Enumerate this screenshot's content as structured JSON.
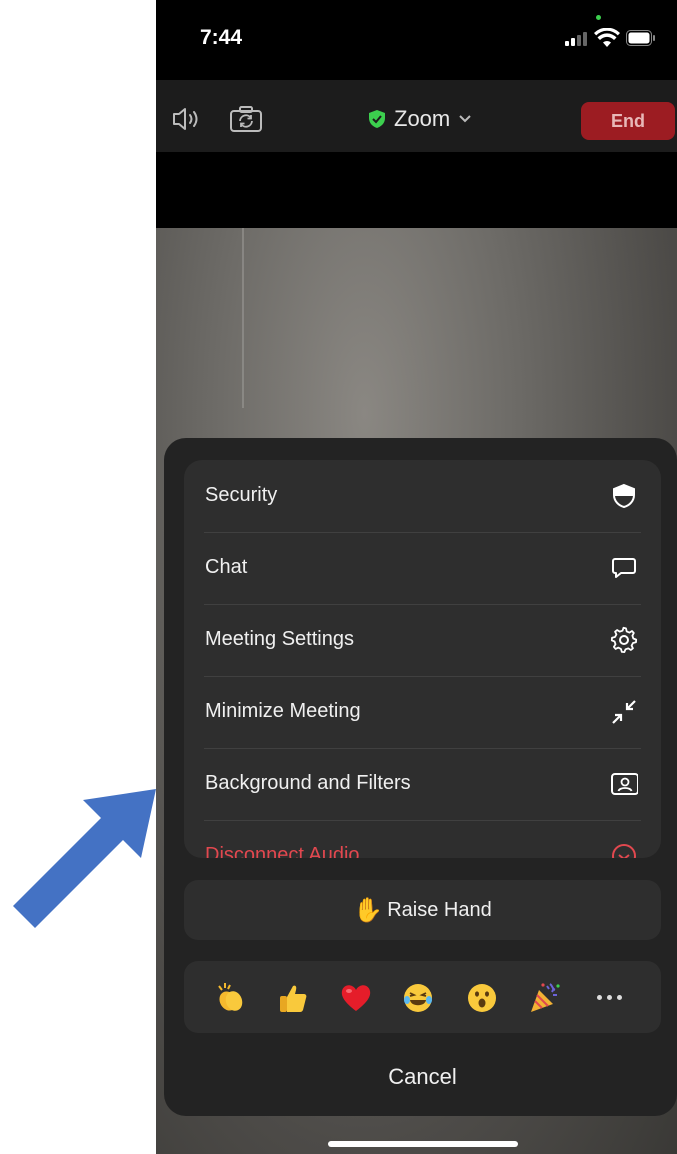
{
  "status_bar": {
    "time": "7:44"
  },
  "toolbar": {
    "meeting_title": "Zoom",
    "end_label": "End"
  },
  "menu": {
    "items": [
      {
        "label": "Security",
        "icon": "shield-icon"
      },
      {
        "label": "Chat",
        "icon": "chat-bubble-icon"
      },
      {
        "label": "Meeting Settings",
        "icon": "gear-icon"
      },
      {
        "label": "Minimize Meeting",
        "icon": "minimize-arrows-icon"
      },
      {
        "label": "Background and Filters",
        "icon": "portrait-frame-icon"
      },
      {
        "label": "Disconnect Audio",
        "icon": "disconnect-audio-icon"
      }
    ]
  },
  "raise_hand": {
    "label": "Raise Hand",
    "emoji": "✋"
  },
  "reactions": {
    "items": [
      "👏",
      "👍",
      "❤️",
      "😂",
      "😮",
      "🎉"
    ]
  },
  "cancel": {
    "label": "Cancel"
  },
  "colors": {
    "end_button": "#9c1c22",
    "danger_text": "#e2484f",
    "shield_green": "#3ccf4e",
    "annotation_arrow": "#4472c4"
  }
}
